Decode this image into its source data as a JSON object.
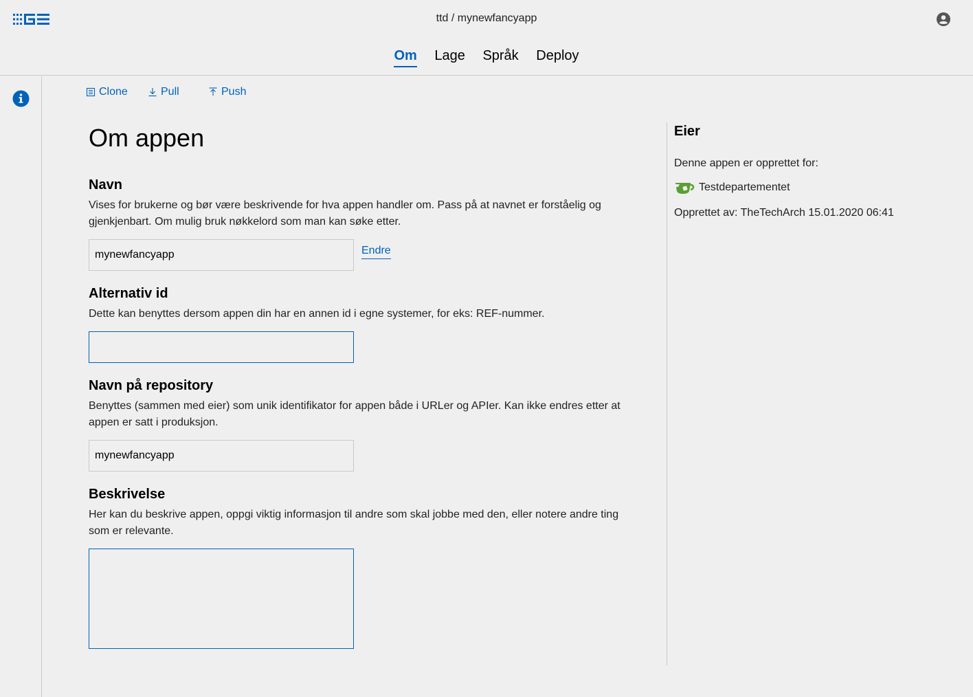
{
  "header": {
    "breadcrumb": "ttd / mynewfancyapp"
  },
  "nav": {
    "tabs": [
      {
        "label": "Om",
        "active": true
      },
      {
        "label": "Lage",
        "active": false
      },
      {
        "label": "Språk",
        "active": false
      },
      {
        "label": "Deploy",
        "active": false
      }
    ]
  },
  "toolbar": {
    "clone_label": "Clone",
    "pull_label": "Pull",
    "push_label": "Push"
  },
  "main": {
    "title": "Om appen",
    "name": {
      "title": "Navn",
      "description": "Vises for brukerne og bør være beskrivende for hva appen handler om. Pass på at navnet er forståelig og gjenkjenbart. Om mulig bruk nøkkelord som man kan søke etter.",
      "value": "mynewfancyapp",
      "edit_label": "Endre"
    },
    "alt_id": {
      "title": "Alternativ id",
      "description": "Dette kan benyttes dersom appen din har en annen id i egne systemer, for eks: REF-nummer.",
      "value": ""
    },
    "repo": {
      "title": "Navn på repository",
      "description": "Benyttes (sammen med eier) som unik identifikator for appen både i URLer og APIer. Kan ikke endres etter at appen er satt i produksjon.",
      "value": "mynewfancyapp"
    },
    "description": {
      "title": "Beskrivelse",
      "description": "Her kan du beskrive appen, oppgi viktig informasjon til andre som skal jobbe med den, eller notere andre ting som er relevante.",
      "value": ""
    }
  },
  "owner": {
    "title": "Eier",
    "created_for_label": "Denne appen er opprettet for:",
    "org_name": "Testdepartementet",
    "created_by": "Opprettet av: TheTechArch 15.01.2020 06:41"
  },
  "colors": {
    "accent": "#0062ba",
    "background": "#efefef",
    "org_logo": "#5a9e33"
  },
  "icons": {
    "logo": "altinn-studio-logo",
    "user": "user-circle-icon",
    "info": "info-icon",
    "clone": "clone-icon",
    "pull": "download-icon",
    "push": "upload-icon",
    "org": "teacup-logo"
  }
}
